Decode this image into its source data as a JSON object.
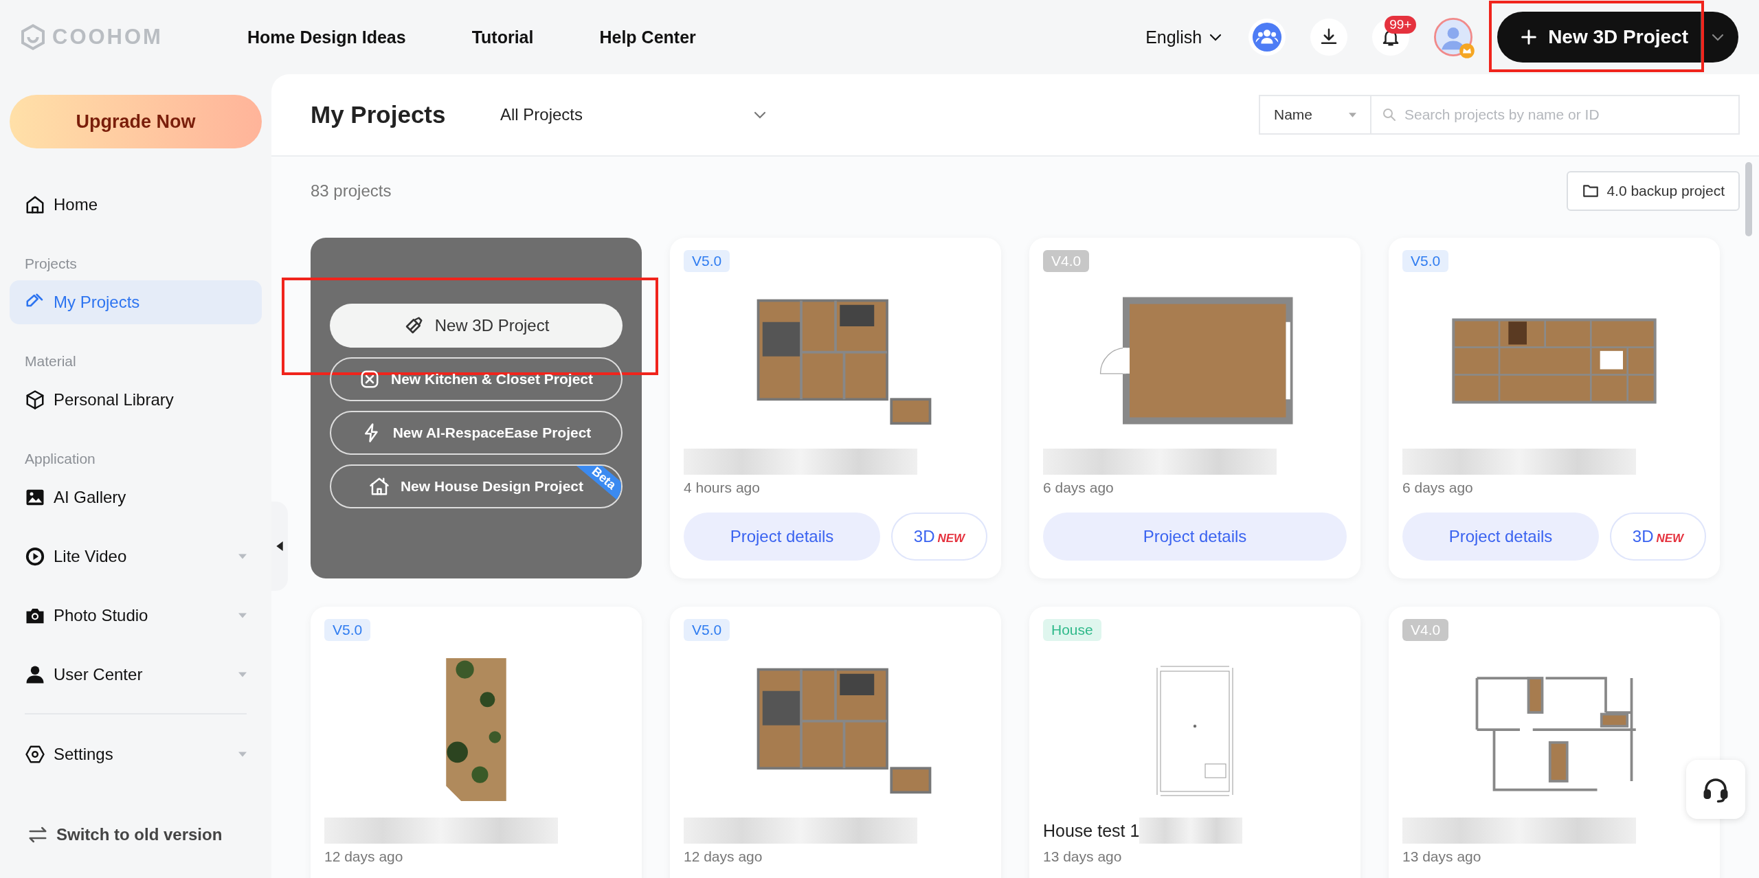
{
  "header": {
    "logo": "COOHOM",
    "nav": [
      "Home Design Ideas",
      "Tutorial",
      "Help Center"
    ],
    "language": "English",
    "notification_count": "99+",
    "new_project_button": "New 3D Project"
  },
  "sidebar": {
    "upgrade_button": "Upgrade Now",
    "items": [
      {
        "kind": "item",
        "label": "Home",
        "selected": false,
        "has_submenu": false
      },
      {
        "kind": "section",
        "label": "Projects"
      },
      {
        "kind": "item",
        "label": "My Projects",
        "selected": true,
        "has_submenu": false
      },
      {
        "kind": "section",
        "label": "Material"
      },
      {
        "kind": "item",
        "label": "Personal Library",
        "selected": false,
        "has_submenu": false
      },
      {
        "kind": "section",
        "label": "Application"
      },
      {
        "kind": "item",
        "label": "AI Gallery",
        "selected": false,
        "has_submenu": false
      },
      {
        "kind": "item",
        "label": "Lite Video",
        "selected": false,
        "has_submenu": true
      },
      {
        "kind": "item",
        "label": "Photo Studio",
        "selected": false,
        "has_submenu": true
      },
      {
        "kind": "item",
        "label": "User Center",
        "selected": false,
        "has_submenu": true
      },
      {
        "kind": "divider"
      },
      {
        "kind": "item",
        "label": "Settings",
        "selected": false,
        "has_submenu": true
      }
    ],
    "footer_link": "Switch to old version"
  },
  "main": {
    "title": "My Projects",
    "filter": "All Projects",
    "sort": "Name",
    "search_placeholder": "Search projects by name or ID",
    "count": "83 projects",
    "backup_button": "4.0 backup project",
    "create_menu": [
      {
        "kind": "primary",
        "label": "New 3D Project"
      },
      {
        "kind": "outline",
        "label": "New Kitchen & Closet Project"
      },
      {
        "kind": "outline",
        "label": "New AI-RespaceEase Project"
      },
      {
        "kind": "outline",
        "label": "New House Design Project",
        "ribbon": "Beta"
      }
    ],
    "projects": [
      {
        "badge": {
          "text": "V5.0",
          "color": "#2f7cf0"
        },
        "time": "4 hours ago",
        "details_button": "Project details",
        "viewer_button": {
          "label": "3D",
          "tag": "NEW"
        }
      },
      {
        "badge": {
          "text": "V4.0",
          "color": "#ffffff"
        },
        "time": "6 days ago",
        "details_button": "Project details"
      },
      {
        "badge": {
          "text": "V5.0",
          "color": "#2f7cf0"
        },
        "time": "6 days ago",
        "details_button": "Project details",
        "viewer_button": {
          "label": "3D",
          "tag": "NEW"
        }
      },
      {
        "badge": {
          "text": "V5.0",
          "color": "#2f7cf0"
        },
        "time": "12 days ago"
      },
      {
        "badge": {
          "text": "V5.0",
          "color": "#2f7cf0"
        },
        "time": "12 days ago"
      },
      {
        "badge": {
          "text": "House",
          "color": "#2fb98a"
        },
        "title": "House test 1",
        "time": "13 days ago"
      },
      {
        "badge": {
          "text": "V4.0",
          "color": "#ffffff"
        },
        "time": "13 days ago"
      }
    ]
  }
}
